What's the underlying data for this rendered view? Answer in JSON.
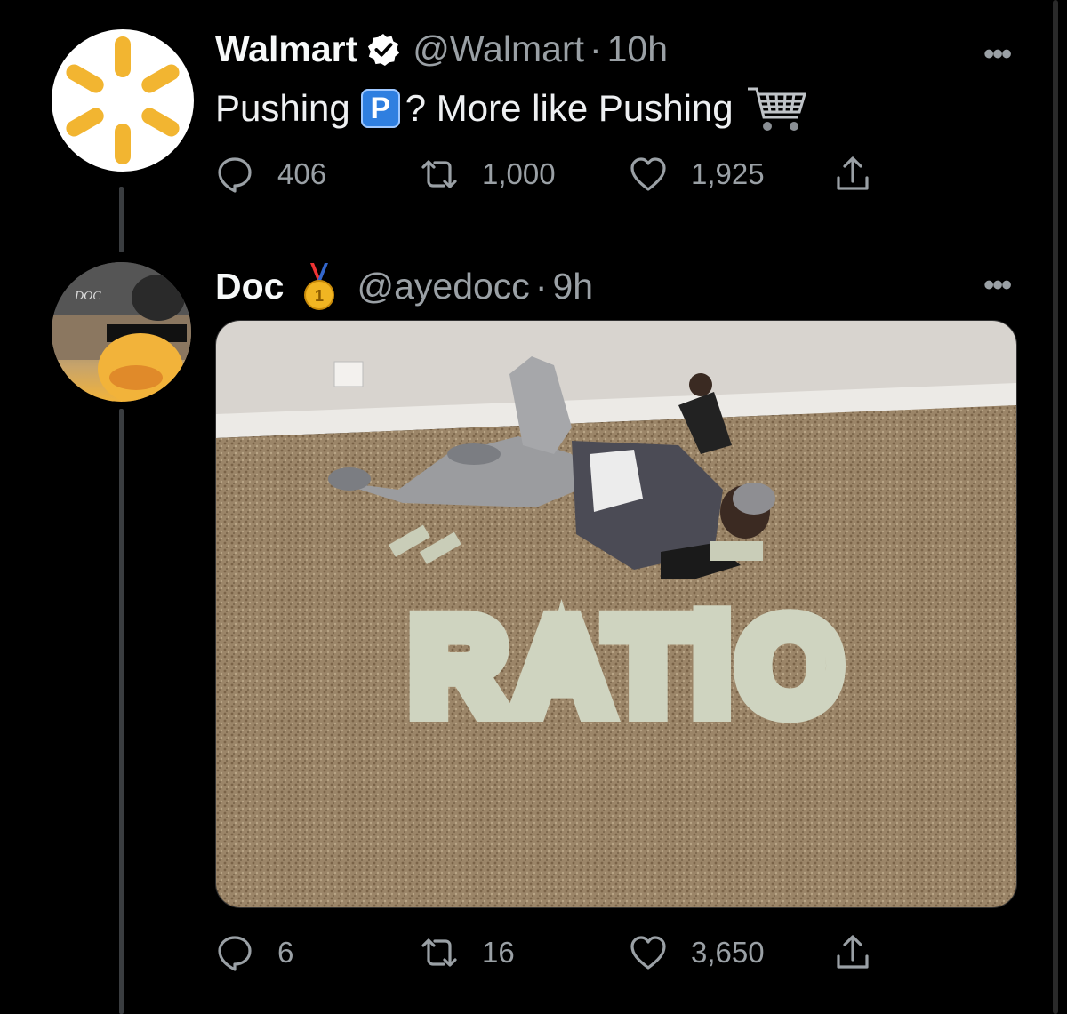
{
  "walmart_tweet": {
    "name": "Walmart",
    "handle": "@Walmart",
    "dot": "·",
    "time": "10h",
    "more": "•••",
    "text_part1": "Pushing",
    "p_emoji": "P",
    "text_part2": "? More like Pushing",
    "reply_count": "406",
    "retweet_count": "1,000",
    "like_count": "1,925"
  },
  "doc_tweet": {
    "name": "Doc",
    "handle": "@ayedocc",
    "dot": "·",
    "time": "9h",
    "more": "•••",
    "medal_digit": "1",
    "image_text": "RATiO",
    "reply_count": "6",
    "retweet_count": "16",
    "like_count": "3,650"
  },
  "avatar_doc_label": "DOC",
  "colors": {
    "background": "#000000",
    "text_primary": "#f7f9f9",
    "text_secondary": "#9aa0a5",
    "thread_line": "#3a3d40",
    "walmart_spark": "#f2b531",
    "verified_bg": "#ffffff"
  }
}
